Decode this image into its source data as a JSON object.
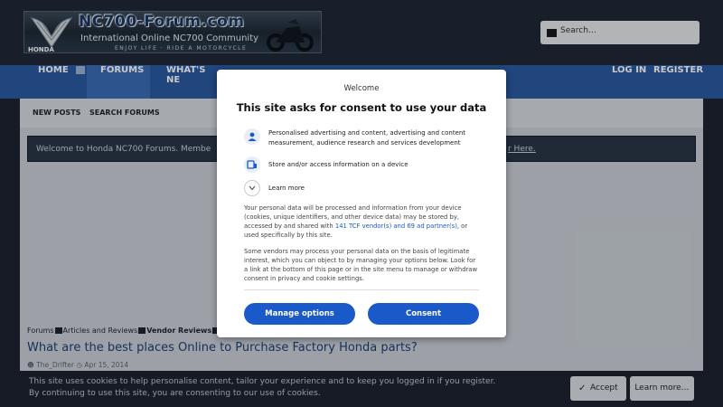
{
  "header": {
    "logo": {
      "brand": "NC700-Forum.com",
      "tagline": "International Online NC700 Community",
      "motto": "ENJOY LIFE · RIDE A MOTORCYCLE",
      "maker": "HONDA"
    },
    "search": {
      "placeholder": "Search…",
      "icon": "search-icon"
    }
  },
  "nav": {
    "items": [
      {
        "label": "HOME",
        "has_dropdown": true
      },
      {
        "label": "FORUMS",
        "active": true
      },
      {
        "label": "WHAT'S NE"
      }
    ],
    "right": [
      {
        "label": "LOG IN"
      },
      {
        "label": "REGISTER"
      }
    ]
  },
  "subnav": {
    "items": [
      "NEW POSTS",
      "SEARCH FORUMS"
    ]
  },
  "notice": {
    "text": "Welcome to Honda NC700 Forums. Membe",
    "link": "r Here."
  },
  "breadcrumb": {
    "items": [
      "Forums",
      "Articles and Reviews",
      "Vendor Reviews"
    ]
  },
  "thread": {
    "title": "What are the best places Online to Purchase Factory Honda parts?",
    "author": "The_Drifter",
    "date": "Apr 15, 2014"
  },
  "cookie_bar": {
    "line1": "This site uses cookies to help personalise content, tailor your experience and to keep you logged in if you register.",
    "line2": "By continuing to use this site, you are consenting to our use of cookies.",
    "accept": "Accept",
    "learn_more": "Learn more…"
  },
  "consent_dialog": {
    "welcome": "Welcome",
    "title": "This site asks for consent to use your data",
    "purposes": [
      {
        "icon": "person-icon",
        "text": "Personalised advertising and content, advertising and content measurement, audience research and services development"
      },
      {
        "icon": "device-storage-icon",
        "text": "Store and/or access information on a device"
      },
      {
        "icon": "chevron-down-icon",
        "text": "Learn more"
      }
    ],
    "body1_a": "Your personal data will be processed and information from your device (cookies, unique identifiers, and other device data) may be stored by, accessed by and shared with ",
    "body1_link": "141 TCF vendor(s) and 69 ad partner(s)",
    "body1_b": ", or used specifically by this site.",
    "body2": "Some vendors may process your personal data on the basis of legitimate interest, which you can object to by managing your options below. Look for a link at the bottom of this page or in the site menu to manage or withdraw consent in privacy and cookie settings.",
    "manage_button": "Manage options",
    "consent_button": "Consent"
  },
  "colors": {
    "nav_bg": "#2a5aa0",
    "header_bg": "#1f2736",
    "consent_blue": "#1a5ac8",
    "notice_bg": "#2a3647"
  }
}
